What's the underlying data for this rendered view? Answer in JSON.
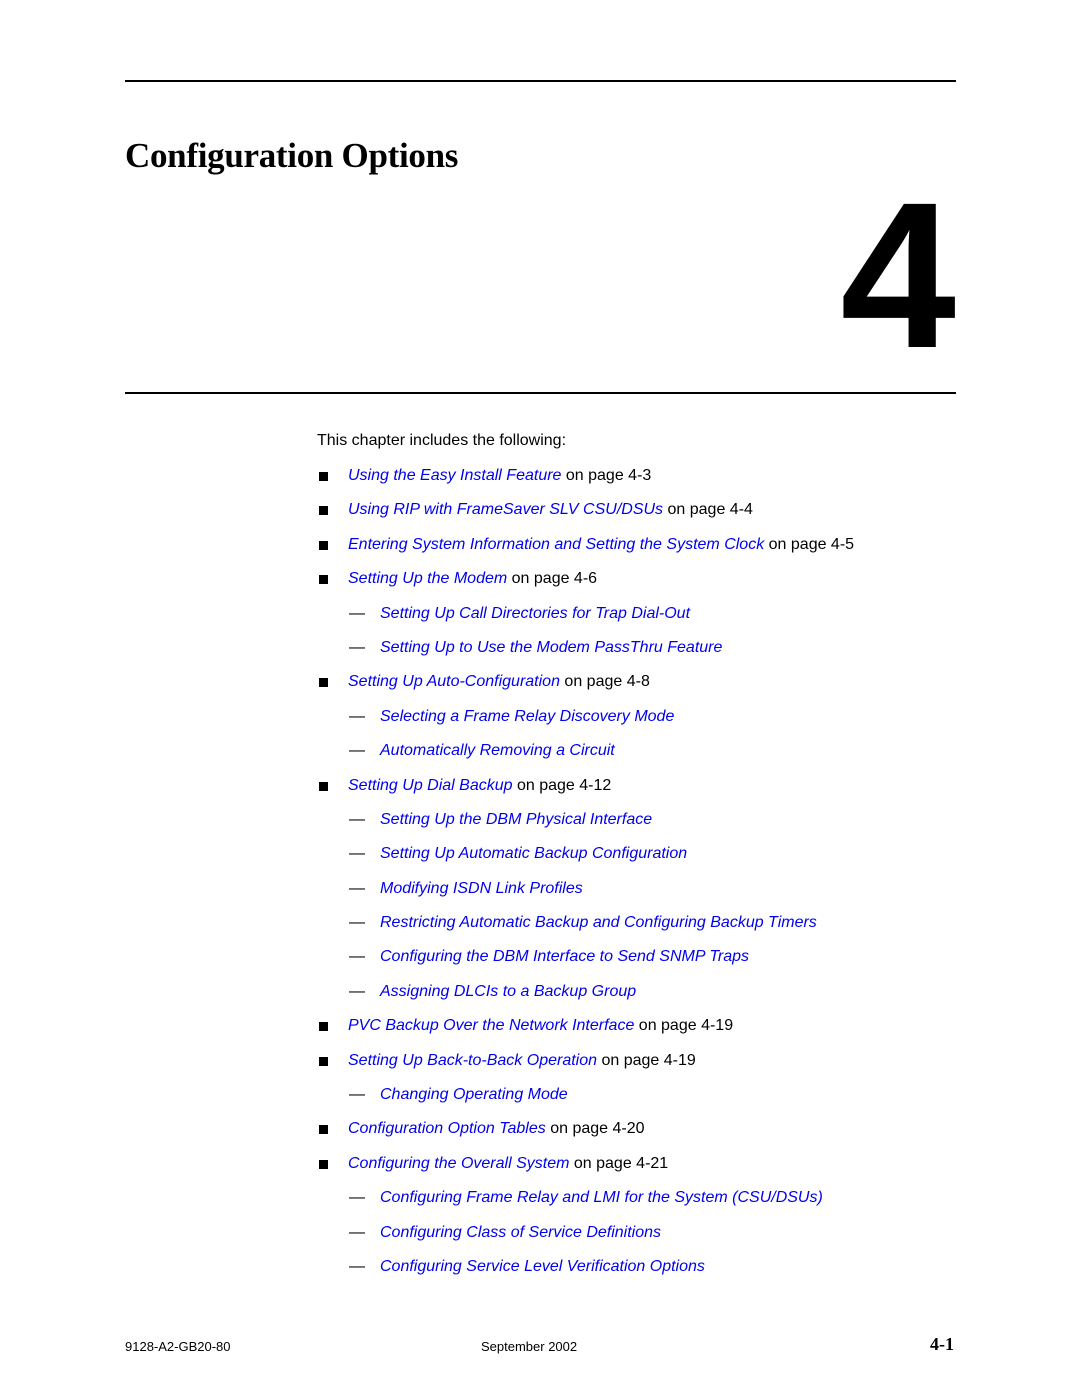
{
  "chapter": {
    "title": "Configuration Options",
    "number": "4"
  },
  "intro": "This chapter includes the following:",
  "toc": [
    {
      "level": 1,
      "link": "Using the Easy Install Feature",
      "suffix": " on page 4-3"
    },
    {
      "level": 1,
      "link": "Using RIP with FrameSaver SLV CSU/DSUs",
      "suffix": " on page 4-4"
    },
    {
      "level": 1,
      "link": "Entering System Information and Setting the System Clock",
      "suffix": " on page 4-5"
    },
    {
      "level": 1,
      "link": "Setting Up the Modem",
      "suffix": " on page 4-6"
    },
    {
      "level": 2,
      "link": "Setting Up Call Directories for Trap Dial-Out",
      "suffix": ""
    },
    {
      "level": 2,
      "link": "Setting Up to Use the Modem PassThru Feature",
      "suffix": ""
    },
    {
      "level": 1,
      "link": "Setting Up Auto-Configuration",
      "suffix": " on page 4-8"
    },
    {
      "level": 2,
      "link": "Selecting a Frame Relay Discovery Mode",
      "suffix": ""
    },
    {
      "level": 2,
      "link": "Automatically Removing a Circuit",
      "suffix": ""
    },
    {
      "level": 1,
      "link": "Setting Up Dial Backup",
      "suffix": " on page 4-12"
    },
    {
      "level": 2,
      "link": "Setting Up the DBM Physical Interface",
      "suffix": ""
    },
    {
      "level": 2,
      "link": "Setting Up Automatic Backup Configuration",
      "suffix": ""
    },
    {
      "level": 2,
      "link": "Modifying ISDN Link Profiles",
      "suffix": ""
    },
    {
      "level": 2,
      "link": "Restricting Automatic Backup and Configuring Backup Timers",
      "suffix": ""
    },
    {
      "level": 2,
      "link": "Configuring the DBM Interface to Send SNMP Traps",
      "suffix": ""
    },
    {
      "level": 2,
      "link": "Assigning DLCIs to a Backup Group",
      "suffix": ""
    },
    {
      "level": 1,
      "link": "PVC Backup Over the Network Interface",
      "suffix": " on page 4-19"
    },
    {
      "level": 1,
      "link": "Setting Up Back-to-Back Operation",
      "suffix": " on page 4-19"
    },
    {
      "level": 2,
      "link": "Changing Operating Mode",
      "suffix": ""
    },
    {
      "level": 1,
      "link": "Configuration Option Tables",
      "suffix": " on page 4-20"
    },
    {
      "level": 1,
      "link": "Configuring the Overall System",
      "suffix": " on page 4-21"
    },
    {
      "level": 2,
      "link": "Configuring Frame Relay and LMI for the System (CSU/DSUs)",
      "suffix": ""
    },
    {
      "level": 2,
      "link": "Configuring Class of Service Definitions",
      "suffix": ""
    },
    {
      "level": 2,
      "link": "Configuring Service Level Verification Options",
      "suffix": ""
    }
  ],
  "symbols": {
    "dash": "—"
  },
  "footer": {
    "doc_number": "9128-A2-GB20-80",
    "date": "September 2002",
    "page": "4-1"
  },
  "colors": {
    "link": "#0000ee",
    "text": "#000000"
  }
}
